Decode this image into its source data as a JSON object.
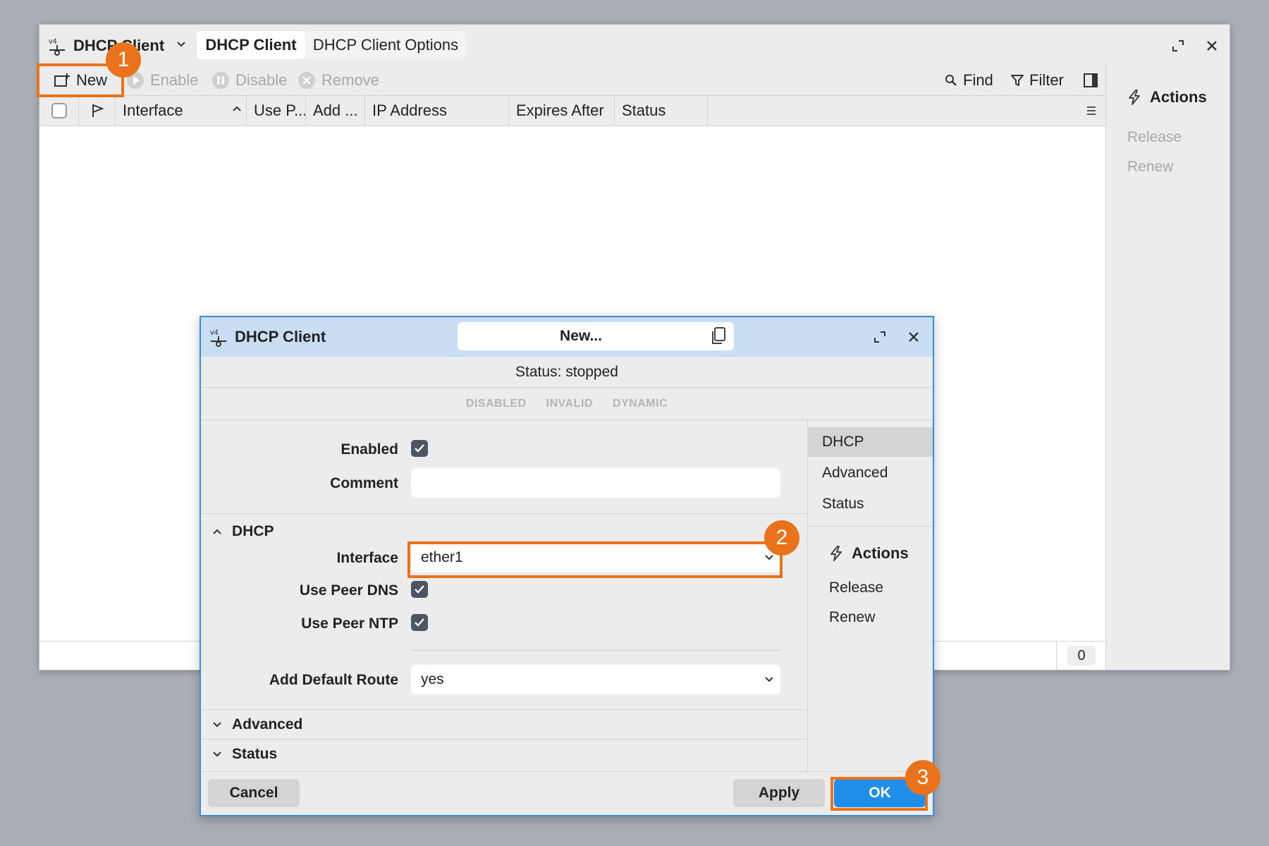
{
  "main_window": {
    "title": "DHCP Client",
    "tabs": [
      {
        "label": "DHCP Client",
        "active": true
      },
      {
        "label": "DHCP Client Options",
        "active": false
      }
    ],
    "toolbar": {
      "new": "New",
      "enable": "Enable",
      "disable": "Disable",
      "remove": "Remove",
      "find": "Find",
      "filter": "Filter"
    },
    "columns": [
      "Interface",
      "Use P...",
      "Add ...",
      "IP Address",
      "Expires After",
      "Status"
    ],
    "sort_column": "Interface",
    "row_count": "0",
    "actions_panel": {
      "title": "Actions",
      "items": [
        "Release",
        "Renew"
      ]
    }
  },
  "dialog": {
    "title": "DHCP Client",
    "name_field": "New...",
    "status": "Status: stopped",
    "flags": [
      "DISABLED",
      "INVALID",
      "DYNAMIC"
    ],
    "fields": {
      "enabled": {
        "label": "Enabled",
        "checked": true
      },
      "comment": {
        "label": "Comment",
        "value": ""
      },
      "interface": {
        "label": "Interface",
        "value": "ether1"
      },
      "use_peer_dns": {
        "label": "Use Peer DNS",
        "checked": true
      },
      "use_peer_ntp": {
        "label": "Use Peer NTP",
        "checked": true
      },
      "add_default_route": {
        "label": "Add Default Route",
        "value": "yes"
      }
    },
    "sections": {
      "dhcp": "DHCP",
      "advanced": "Advanced",
      "status": "Status"
    },
    "side_nav": [
      "DHCP",
      "Advanced",
      "Status"
    ],
    "side_nav_active": "DHCP",
    "side_actions": {
      "title": "Actions",
      "items": [
        "Release",
        "Renew"
      ]
    },
    "buttons": {
      "cancel": "Cancel",
      "apply": "Apply",
      "ok": "OK"
    }
  },
  "annotations": {
    "step1": "1",
    "step2": "2",
    "step3": "3",
    "color": "#e8731c"
  },
  "colors": {
    "accent_blue": "#1f8ee8",
    "dialog_title_bg": "#c9def2",
    "highlight_orange": "#e8731c"
  }
}
